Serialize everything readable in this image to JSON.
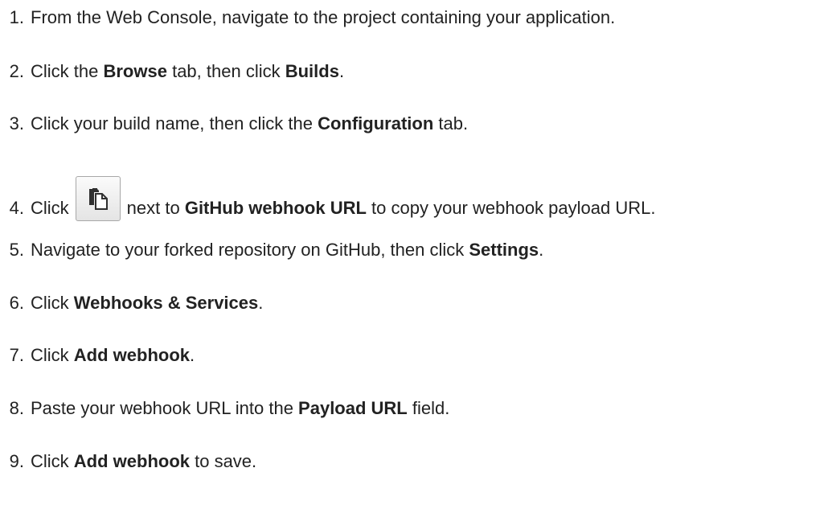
{
  "steps": [
    {
      "num": "1.",
      "parts": [
        "From the Web Console, navigate to the project containing your application."
      ]
    },
    {
      "num": "2.",
      "parts": [
        "Click the ",
        "Browse",
        " tab, then click ",
        "Builds",
        "."
      ]
    },
    {
      "num": "3.",
      "parts": [
        "Click your build name, then click the ",
        "Configuration",
        " tab."
      ]
    },
    {
      "num": "4.",
      "parts": [
        "Click",
        "next to ",
        "GitHub webhook URL",
        " to copy your webhook payload URL."
      ]
    },
    {
      "num": "5.",
      "parts": [
        "Navigate to your forked repository on GitHub, then click ",
        "Settings",
        "."
      ]
    },
    {
      "num": "6.",
      "parts": [
        "Click ",
        "Webhooks & Services",
        "."
      ]
    },
    {
      "num": "7.",
      "parts": [
        "Click ",
        "Add webhook",
        "."
      ]
    },
    {
      "num": "8.",
      "parts": [
        "Paste your webhook URL into the ",
        "Payload URL",
        " field."
      ]
    },
    {
      "num": "9.",
      "parts": [
        "Click ",
        "Add webhook",
        " to save."
      ]
    }
  ],
  "copy_button": {
    "icon": "copy-icon"
  }
}
